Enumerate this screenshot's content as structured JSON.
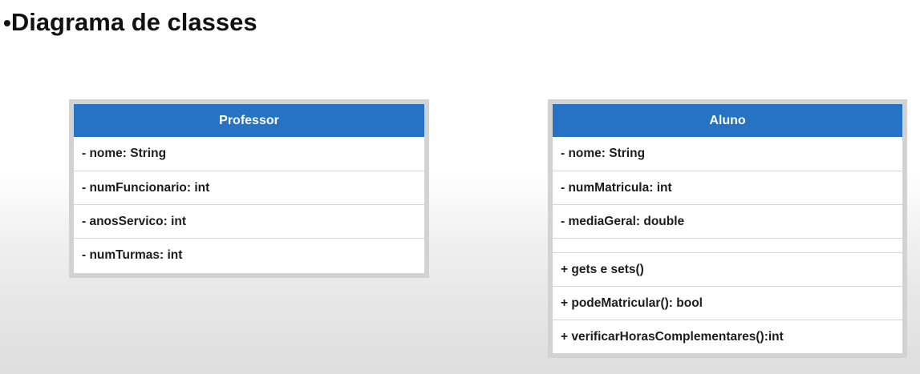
{
  "title": {
    "bullet": "•",
    "text": "Diagrama de classes"
  },
  "classes": [
    {
      "name": "Professor",
      "attributes": [
        "- nome: String",
        "- numFuncionario: int",
        "- anosServico: int",
        "- numTurmas: int"
      ],
      "methods": []
    },
    {
      "name": "Aluno",
      "attributes": [
        "- nome: String",
        "- numMatricula: int",
        "- mediaGeral: double"
      ],
      "methods": [
        "+ gets e sets()",
        "+ podeMatricular(): bool",
        "+ verificarHorasComplementares():int"
      ]
    }
  ],
  "colors": {
    "header_bg": "#2673c5",
    "header_text": "#ffffff",
    "frame": "#d2d2d2"
  }
}
